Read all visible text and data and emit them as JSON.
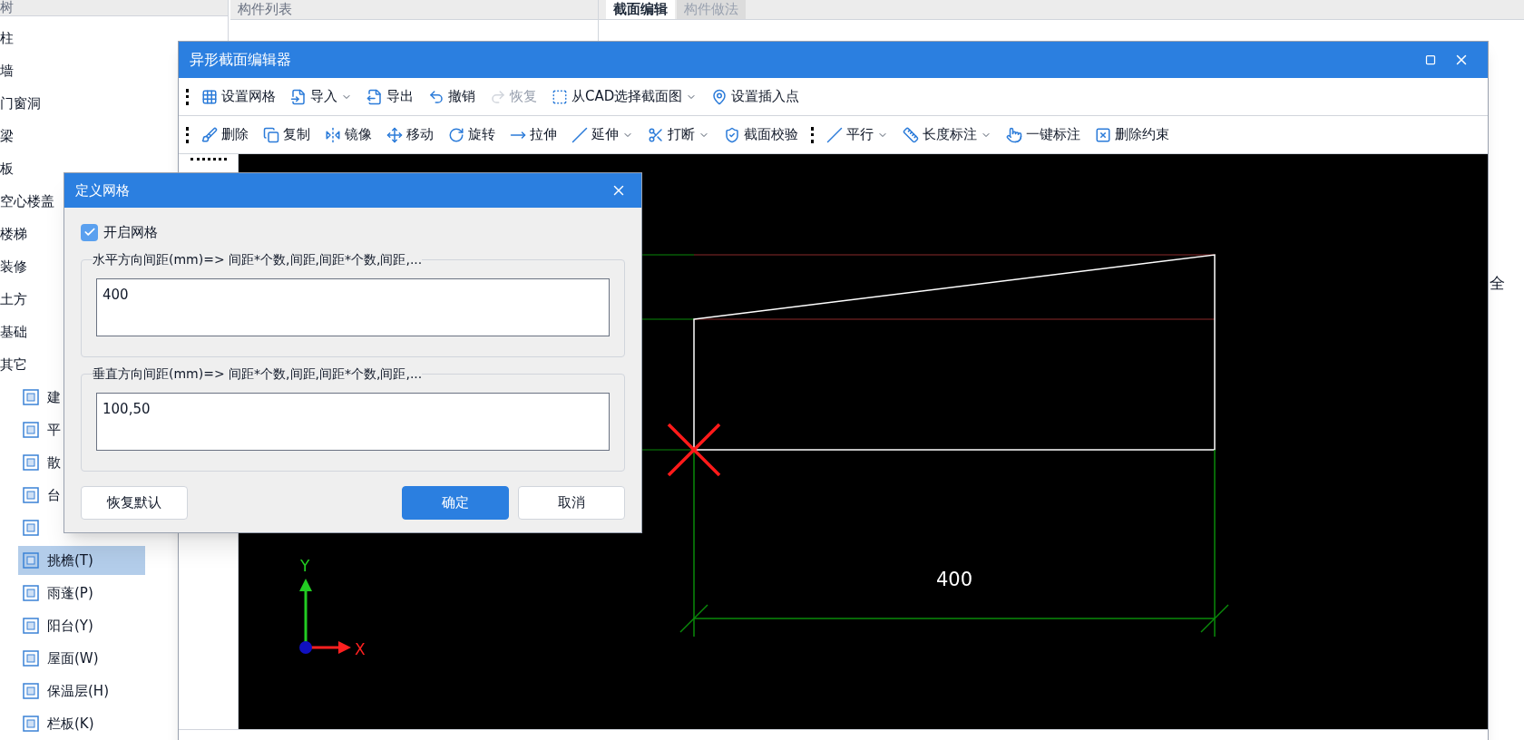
{
  "tree_panel": {
    "title": "树",
    "items": [
      {
        "label": "柱",
        "selected": false
      },
      {
        "label": "墙",
        "selected": false
      },
      {
        "label": "门窗洞",
        "selected": false
      },
      {
        "label": "梁",
        "selected": false
      },
      {
        "label": "板",
        "selected": false
      },
      {
        "label": "空心楼盖",
        "selected": false
      },
      {
        "label": "楼梯",
        "selected": false
      },
      {
        "label": "装修",
        "selected": false
      },
      {
        "label": "土方",
        "selected": false
      },
      {
        "label": "基础",
        "selected": false
      },
      {
        "label": "其它",
        "selected": false,
        "children": [
          {
            "label": "建",
            "selected": false
          },
          {
            "label": "平",
            "selected": false
          },
          {
            "label": "散",
            "selected": false
          },
          {
            "label": "台",
            "selected": false
          },
          {
            "selected": false
          },
          {
            "label": "挑檐(T)",
            "selected": true
          },
          {
            "label": "雨蓬(P)",
            "selected": false
          },
          {
            "label": "阳台(Y)",
            "selected": false
          },
          {
            "label": "屋面(W)",
            "selected": false
          },
          {
            "label": "保温层(H)",
            "selected": false
          },
          {
            "label": "栏板(K)",
            "selected": false
          }
        ]
      }
    ]
  },
  "list_panel": {
    "title": "构件列表"
  },
  "right_panel": {
    "tabs": [
      {
        "label": "截面编辑",
        "selected": true
      },
      {
        "label": "构件做法",
        "selected": false
      }
    ],
    "side_text": "全"
  },
  "editor": {
    "title": "异形截面编辑器",
    "toolbar_1": [
      {
        "label": "设置网格",
        "menu": false,
        "disabled": false
      },
      {
        "label": "导入",
        "menu": true,
        "disabled": false
      },
      {
        "label": "导出",
        "menu": false,
        "disabled": false
      },
      {
        "label": "撤销",
        "menu": false,
        "disabled": false
      },
      {
        "label": "恢复",
        "menu": false,
        "disabled": true
      },
      {
        "label": "从CAD选择截面图",
        "menu": true,
        "disabled": false
      },
      {
        "label": "设置插入点",
        "menu": false,
        "disabled": false
      }
    ],
    "toolbar_2": [
      {
        "label": "删除",
        "menu": false
      },
      {
        "label": "复制",
        "menu": false
      },
      {
        "label": "镜像",
        "menu": false
      },
      {
        "label": "移动",
        "menu": false
      },
      {
        "label": "旋转",
        "menu": false
      },
      {
        "label": "拉伸",
        "menu": false
      },
      {
        "label": "延伸",
        "menu": true
      },
      {
        "label": "打断",
        "menu": true
      },
      {
        "label": "截面校验",
        "menu": false
      }
    ],
    "toolbar_3": [
      {
        "label": "平行",
        "menu": true
      },
      {
        "label": "长度标注",
        "menu": true
      },
      {
        "label": "一键标注",
        "menu": false
      },
      {
        "label": "删除约束",
        "menu": false
      }
    ],
    "canvas": {
      "dimension": "400",
      "axis_y": "Y",
      "axis_x": "X"
    }
  },
  "grid_dialog": {
    "title": "定义网格",
    "enable_grid": {
      "label": "开启网格",
      "checked": true
    },
    "groups": [
      {
        "label": "水平方向间距(mm)=> 间距*个数,间距,间距*个数,间距,...",
        "value": "400"
      },
      {
        "label": "垂直方向间距(mm)=> 间距*个数,间距,间距*个数,间距,...",
        "value": "100,50"
      }
    ],
    "buttons": [
      {
        "label": "恢复默认",
        "kind": "default"
      },
      {
        "label": "确定",
        "kind": "primary"
      },
      {
        "label": "取消",
        "kind": "default"
      }
    ]
  }
}
